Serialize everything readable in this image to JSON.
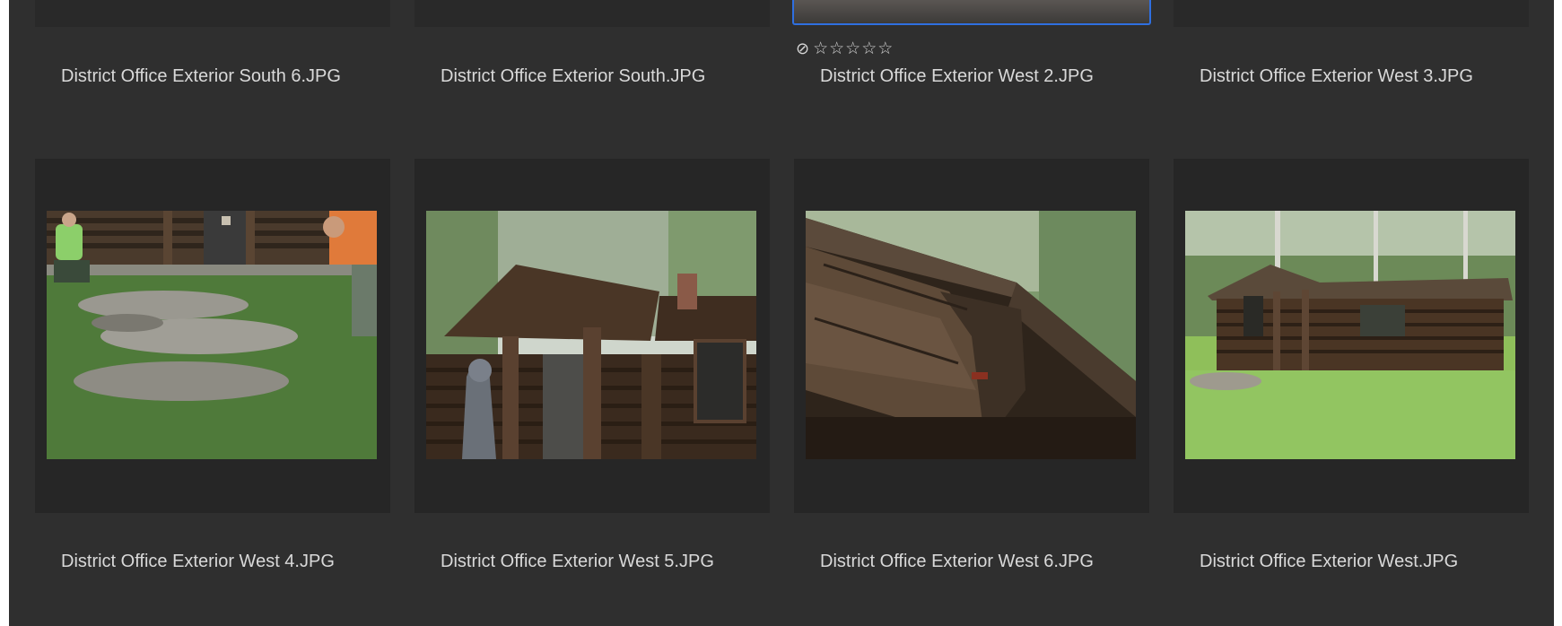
{
  "top_row": [
    {
      "filename": "District Office Exterior South 6.JPG",
      "selected": false
    },
    {
      "filename": "District Office Exterior South.JPG",
      "selected": false
    },
    {
      "filename": "District Office Exterior West 2.JPG",
      "selected": true,
      "rating": {
        "reject_icon": "⊘",
        "stars": "☆☆☆☆☆"
      }
    },
    {
      "filename": "District Office Exterior West 3.JPG",
      "selected": false
    }
  ],
  "bottom_row": [
    {
      "filename": "District Office Exterior West 4.JPG"
    },
    {
      "filename": "District Office Exterior West 5.JPG"
    },
    {
      "filename": "District Office Exterior West 6.JPG"
    },
    {
      "filename": "District Office Exterior West.JPG"
    }
  ],
  "colors": {
    "background": "#2f2f2f",
    "card": "#262626",
    "selection": "#2f6fe0",
    "text": "#d9d9d9"
  }
}
